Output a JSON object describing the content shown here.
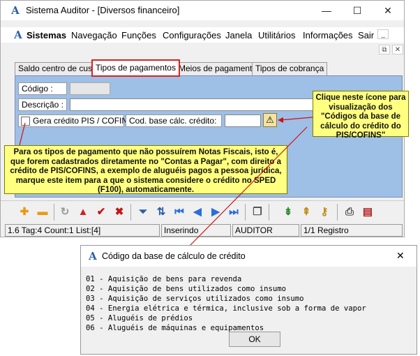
{
  "window": {
    "title": "Sistema Auditor - [Diversos financeiro]",
    "controls": {
      "minimize": "—",
      "maximize": "☐",
      "close": "✕"
    },
    "mdi_controls": {
      "minimize": "_",
      "restore": "⧉",
      "close": "✕"
    }
  },
  "menu": {
    "items": [
      "Sistemas",
      "Navegação",
      "Funções",
      "Configurações",
      "Janela",
      "Utilitários",
      "Informações",
      "Sair"
    ]
  },
  "tabs": [
    {
      "label": "Saldo centro de custo",
      "active": false
    },
    {
      "label": "Tipos de pagamentos",
      "active": true
    },
    {
      "label": "Meios de pagamento",
      "active": false
    },
    {
      "label": "Tipos de cobrança",
      "active": false
    }
  ],
  "form": {
    "codigo_label": "Código :",
    "codigo_value": "",
    "descricao_label": "Descrição :",
    "descricao_value": "",
    "checkbox_label": "Gera crédito PIS / COFINS",
    "checkbox_checked": false,
    "cod_base_label": "Cod. base cálc. crédito:",
    "cod_base_value": ""
  },
  "callouts": {
    "right": "Clique neste ícone para visualização dos \"Códigos da base de cálculo do crédito do PIS/COFINS\"",
    "left": "Para os tipos de pagamento que não possuírem Notas Fiscais, isto é, que forem cadastrados diretamente no \"Contas a Pagar\", com  direito a crédito de PIS/COFINS, a exemplo de aluguéis pagos a pessoa jurídica, marque este item para a que o sistema considere o crédito no SPED (F100), automaticamente."
  },
  "toolbar": {
    "icons": [
      "add-icon",
      "remove-icon",
      "refresh-icon",
      "first-icon",
      "confirm-icon",
      "cancel-icon",
      "filter-icon",
      "sort-icon",
      "first-record-icon",
      "prev-record-icon",
      "next-record-icon",
      "last-record-icon",
      "copy-icon",
      "export-icon",
      "import-icon",
      "key-icon",
      "print-icon",
      "report-icon"
    ]
  },
  "status": {
    "info": "1.6 Tag:4 Count:1 List:[4]",
    "mode": "Inserindo",
    "user": "AUDITOR",
    "record": "1/1 Registro"
  },
  "dialog": {
    "title": "Código da base de cálculo de crédito",
    "close": "✕",
    "lines": [
      "01 - Aquisição de bens para revenda",
      "02 - Aquisição de bens utilizados como insumo",
      "03 - Aquisição de serviços utilizados como insumo",
      "04 - Energia elétrica e térmica, inclusive sob a forma de vapor",
      "05 - Aluguéis de prédios",
      "06 - Aluguéis de máquinas e equipamentos"
    ],
    "ok_label": "OK"
  },
  "colors": {
    "panel": "#9ebfe6",
    "highlight": "#e02020",
    "callout": "#ffff80"
  }
}
